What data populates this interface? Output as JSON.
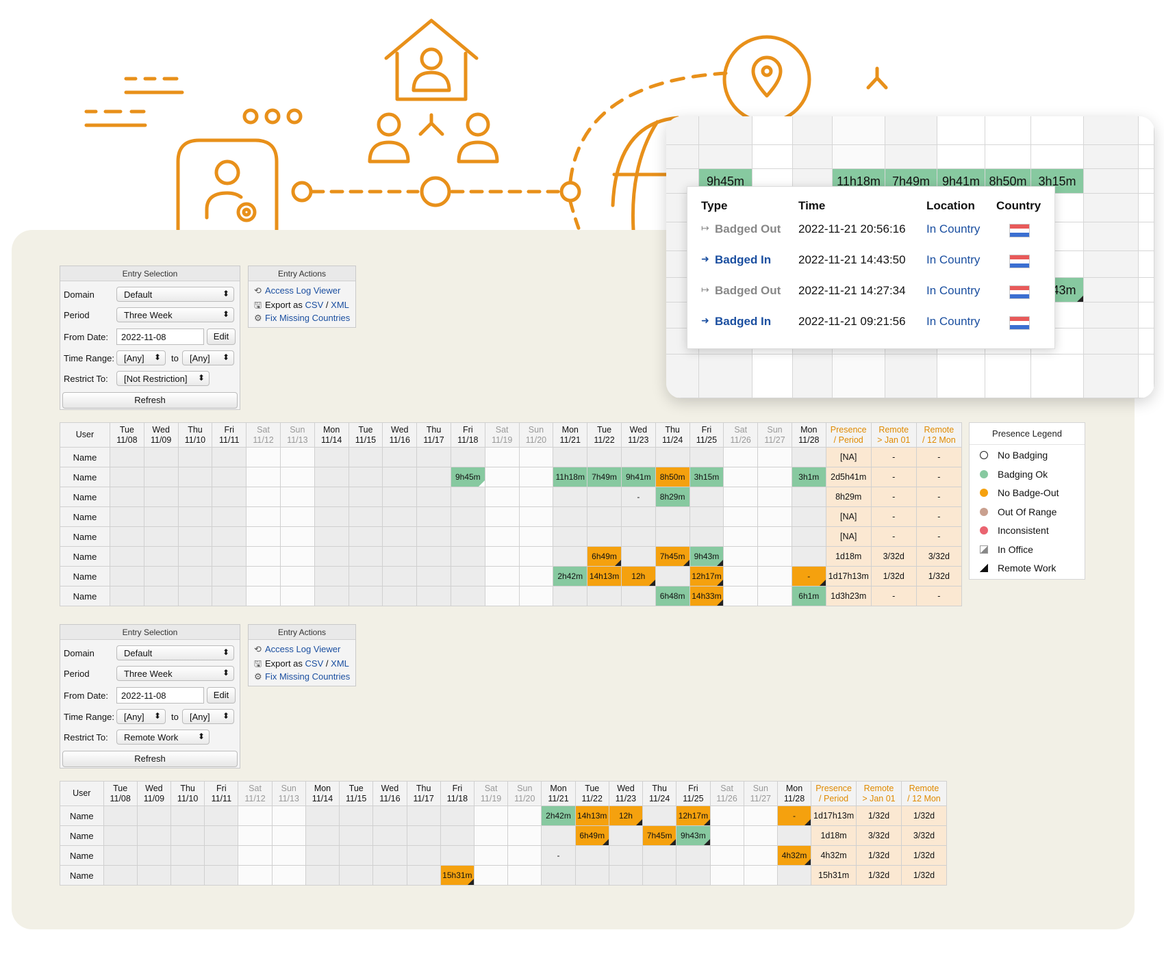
{
  "colors": {
    "orange": "#e8901a",
    "green": "#87c9a0",
    "amber": "#f5a10e",
    "summary": "#fbe8d2",
    "panel": "#f2f0e6",
    "link": "#1b4fa0"
  },
  "entry_selection_title": "Entry Selection",
  "entry_actions_title": "Entry Actions",
  "labels": {
    "domain": "Domain",
    "period": "Period",
    "from_date": "From Date:",
    "time_range": "Time Range:",
    "to": "to",
    "restrict_to": "Restrict To:",
    "edit": "Edit",
    "refresh": "Refresh"
  },
  "actions": {
    "access_log": "Access Log Viewer",
    "export_as": "Export as",
    "csv": "CSV",
    "slash": "/",
    "xml": "XML",
    "fix": "Fix Missing Countries",
    "icons": [
      "history-icon",
      "floppy-icon",
      "gear-icon"
    ]
  },
  "form1": {
    "domain": "Default",
    "period": "Three Week",
    "from_date": "2022-11-08",
    "range_from": "[Any]",
    "range_to": "[Any]",
    "restrict": "[Not Restriction]"
  },
  "form2": {
    "domain": "Default",
    "period": "Three Week",
    "from_date": "2022-11-08",
    "range_from": "[Any]",
    "range_to": "[Any]",
    "restrict": "Remote Work"
  },
  "table_headers": {
    "user": "User",
    "days": [
      [
        "Tue",
        "11/08"
      ],
      [
        "Wed",
        "11/09"
      ],
      [
        "Thu",
        "11/10"
      ],
      [
        "Fri",
        "11/11"
      ],
      [
        "Sat",
        "11/12"
      ],
      [
        "Sun",
        "11/13"
      ],
      [
        "Mon",
        "11/14"
      ],
      [
        "Tue",
        "11/15"
      ],
      [
        "Wed",
        "11/16"
      ],
      [
        "Thu",
        "11/17"
      ],
      [
        "Fri",
        "11/18"
      ],
      [
        "Sat",
        "11/19"
      ],
      [
        "Sun",
        "11/20"
      ],
      [
        "Mon",
        "11/21"
      ],
      [
        "Tue",
        "11/22"
      ],
      [
        "Wed",
        "11/23"
      ],
      [
        "Thu",
        "11/24"
      ],
      [
        "Fri",
        "11/25"
      ],
      [
        "Sat",
        "11/26"
      ],
      [
        "Sun",
        "11/27"
      ],
      [
        "Mon",
        "11/28"
      ]
    ],
    "summary": [
      [
        "Presence",
        "/ Period"
      ],
      [
        "Remote",
        "> Jan 01"
      ],
      [
        "Remote",
        "/ 12 Mon"
      ]
    ]
  },
  "table1": [
    {
      "user": "Name",
      "cells": {},
      "summary": [
        "[NA]",
        "-",
        "-"
      ]
    },
    {
      "user": "Name",
      "cells": {
        "10": [
          "9h45m",
          "g",
          "w"
        ],
        "13": [
          "11h18m",
          "g",
          ""
        ],
        "14": [
          "7h49m",
          "g",
          ""
        ],
        "15": [
          "9h41m",
          "g",
          ""
        ],
        "16": [
          "8h50m",
          "o",
          "w"
        ],
        "17": [
          "3h15m",
          "g",
          ""
        ],
        "20": [
          "3h1m",
          "g",
          ""
        ]
      },
      "summary": [
        "2d5h41m",
        "-",
        "-"
      ]
    },
    {
      "user": "Name",
      "cells": {
        "15": [
          "-",
          "",
          ""
        ],
        "16": [
          "8h29m",
          "g",
          ""
        ]
      },
      "summary": [
        "8h29m",
        "-",
        "-"
      ]
    },
    {
      "user": "Name",
      "cells": {},
      "summary": [
        "[NA]",
        "-",
        "-"
      ]
    },
    {
      "user": "Name",
      "cells": {},
      "summary": [
        "[NA]",
        "-",
        "-"
      ]
    },
    {
      "user": "Name",
      "cells": {
        "14": [
          "6h49m",
          "o",
          "b"
        ],
        "16": [
          "7h45m",
          "o",
          "b"
        ],
        "17": [
          "9h43m",
          "g",
          "b"
        ]
      },
      "summary": [
        "1d18m",
        "3/32d",
        "3/32d"
      ]
    },
    {
      "user": "Name",
      "cells": {
        "13": [
          "2h42m",
          "g",
          ""
        ],
        "14": [
          "14h13m",
          "o",
          ""
        ],
        "15": [
          "12h",
          "o",
          "b"
        ],
        "17": [
          "12h17m",
          "o",
          "b"
        ],
        "20": [
          "-",
          "o",
          "b"
        ]
      },
      "summary": [
        "1d17h13m",
        "1/32d",
        "1/32d"
      ]
    },
    {
      "user": "Name",
      "cells": {
        "16": [
          "6h48m",
          "g",
          ""
        ],
        "17": [
          "14h33m",
          "o",
          "b"
        ],
        "20": [
          "6h1m",
          "g",
          ""
        ]
      },
      "summary": [
        "1d3h23m",
        "-",
        "-"
      ]
    }
  ],
  "table2": [
    {
      "user": "Name",
      "cells": {
        "13": [
          "2h42m",
          "g",
          ""
        ],
        "14": [
          "14h13m",
          "o",
          ""
        ],
        "15": [
          "12h",
          "o",
          "b"
        ],
        "17": [
          "12h17m",
          "o",
          "b"
        ],
        "20": [
          "-",
          "o",
          "b"
        ]
      },
      "summary": [
        "1d17h13m",
        "1/32d",
        "1/32d"
      ]
    },
    {
      "user": "Name",
      "cells": {
        "14": [
          "6h49m",
          "o",
          "b"
        ],
        "16": [
          "7h45m",
          "o",
          "b"
        ],
        "17": [
          "9h43m",
          "g",
          "b"
        ]
      },
      "summary": [
        "1d18m",
        "3/32d",
        "3/32d"
      ]
    },
    {
      "user": "Name",
      "cells": {
        "13": [
          "-",
          "",
          ""
        ],
        "20": [
          "4h32m",
          "o",
          "b"
        ]
      },
      "summary": [
        "4h32m",
        "1/32d",
        "1/32d"
      ]
    },
    {
      "user": "Name",
      "cells": {
        "10": [
          "15h31m",
          "o",
          "b"
        ]
      },
      "summary": [
        "15h31m",
        "1/32d",
        "1/32d"
      ]
    }
  ],
  "legend": {
    "title": "Presence Legend",
    "items": [
      {
        "label": "No Badging",
        "swatch": "#ffffff",
        "icon": "empty-circle-icon"
      },
      {
        "label": "Badging Ok",
        "swatch": "#87c9a0",
        "icon": "green-dot-icon"
      },
      {
        "label": "No Badge-Out",
        "swatch": "#f5a10e",
        "icon": "orange-dot-icon"
      },
      {
        "label": "Out Of Range",
        "swatch": "#c9a08f",
        "icon": "brown-dot-icon"
      },
      {
        "label": "Inconsistent",
        "swatch": "#ea6470",
        "icon": "red-dot-icon"
      },
      {
        "label": "In Office",
        "swatch": "",
        "icon": "in-office-icon"
      },
      {
        "label": "Remote Work",
        "swatch": "",
        "icon": "remote-work-icon"
      }
    ]
  },
  "zoom": {
    "cells": [
      "9h45m",
      "11h18m",
      "7h49m",
      "9h41m",
      "8h50m",
      "3h15m",
      "9h43m"
    ]
  },
  "tooltip": {
    "headers": [
      "Type",
      "Time",
      "Location",
      "Country"
    ],
    "rows": [
      {
        "type": "Badged Out",
        "time": "2022-11-21 20:56:16",
        "location": "In Country",
        "icon": "sign-out-icon"
      },
      {
        "type": "Badged In",
        "time": "2022-11-21 14:43:50",
        "location": "In Country",
        "icon": "sign-in-icon"
      },
      {
        "type": "Badged Out",
        "time": "2022-11-21 14:27:34",
        "location": "In Country",
        "icon": "sign-out-icon"
      },
      {
        "type": "Badged In",
        "time": "2022-11-21 09:21:56",
        "location": "In Country",
        "icon": "sign-in-icon"
      }
    ]
  }
}
